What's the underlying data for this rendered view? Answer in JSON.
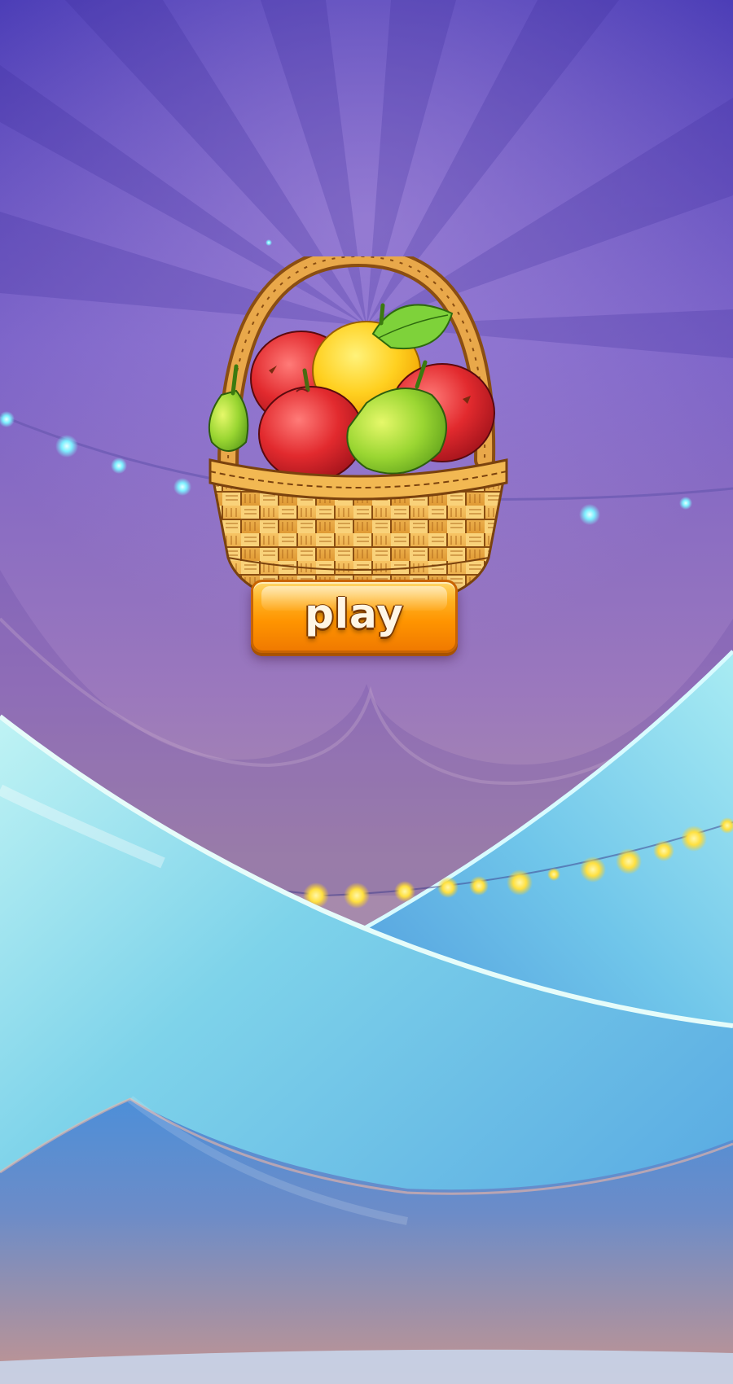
{
  "game": {
    "play_button_label": "play"
  },
  "theme": {
    "sky_top": "#4e3fb8",
    "sky_mid": "#8a6fc4",
    "sky_bottom": "#b58ea8",
    "tent_blue": "#5fb8e8",
    "tent_light": "#9fe4ee",
    "light_bulb": "#ffe34a",
    "button_orange": "#ff9a00"
  },
  "icons": {
    "basket": "fruit-basket-icon",
    "apple": "apple-icon",
    "pear": "pear-icon",
    "orange": "orange-icon",
    "leaf": "leaf-icon"
  }
}
